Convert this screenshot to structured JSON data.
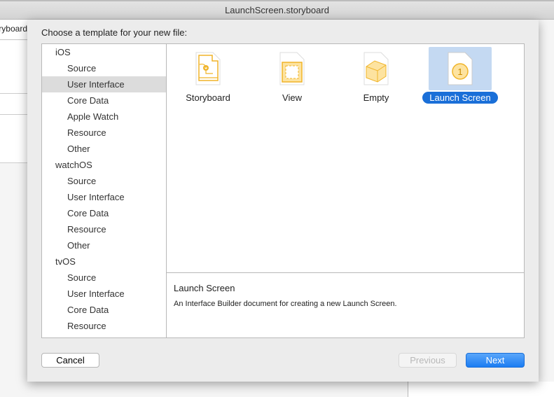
{
  "window": {
    "title": "LaunchScreen.storyboard",
    "background_tab": "LaunchScreen.storyboard"
  },
  "dialog": {
    "prompt": "Choose a template for your new file:",
    "sidebar": [
      {
        "label": "iOS",
        "header": true
      },
      {
        "label": "Source"
      },
      {
        "label": "User Interface",
        "selected": true
      },
      {
        "label": "Core Data"
      },
      {
        "label": "Apple Watch"
      },
      {
        "label": "Resource"
      },
      {
        "label": "Other"
      },
      {
        "label": "watchOS",
        "header": true
      },
      {
        "label": "Source"
      },
      {
        "label": "User Interface"
      },
      {
        "label": "Core Data"
      },
      {
        "label": "Resource"
      },
      {
        "label": "Other"
      },
      {
        "label": "tvOS",
        "header": true
      },
      {
        "label": "Source"
      },
      {
        "label": "User Interface"
      },
      {
        "label": "Core Data"
      },
      {
        "label": "Resource"
      }
    ],
    "templates": [
      {
        "label": "Storyboard",
        "icon": "storyboard-icon"
      },
      {
        "label": "View",
        "icon": "view-icon"
      },
      {
        "label": "Empty",
        "icon": "empty-icon"
      },
      {
        "label": "Launch Screen",
        "icon": "launch-screen-icon",
        "selected": true
      }
    ],
    "launch_icon_number": "1",
    "description": {
      "title": "Launch Screen",
      "text": "An Interface Builder document for creating a new Launch Screen."
    },
    "buttons": {
      "cancel": "Cancel",
      "previous": "Previous",
      "next": "Next"
    },
    "colors": {
      "accent": "#1a6fd8",
      "icon": "#f0b429"
    }
  }
}
